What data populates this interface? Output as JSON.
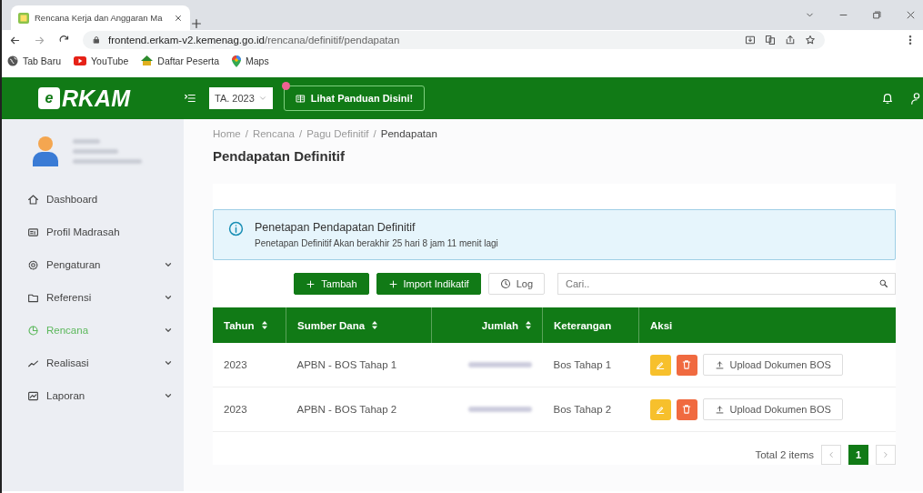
{
  "browser": {
    "tab_title": "Rencana Kerja dan Anggaran Ma",
    "url_host": "frontend.erkam-v2.kemenag.go.id",
    "url_path": "/rencana/definitif/pendapatan",
    "bookmarks": [
      {
        "label": "Tab Baru",
        "kind": "globe"
      },
      {
        "label": "YouTube",
        "kind": "youtube"
      },
      {
        "label": "Daftar Peserta",
        "kind": "emblem"
      },
      {
        "label": "Maps",
        "kind": "maps"
      }
    ]
  },
  "header": {
    "logo": "RKAM",
    "logo_mark": "e",
    "year_select": "TA. 2023",
    "guide_button": "Lihat Panduan Disini!"
  },
  "sidebar": {
    "items": [
      {
        "label": "Dashboard",
        "kind": "link",
        "selected": false
      },
      {
        "label": "Profil Madrasah",
        "kind": "link",
        "selected": false
      },
      {
        "label": "Pengaturan",
        "kind": "group",
        "selected": false
      },
      {
        "label": "Referensi",
        "kind": "group",
        "selected": false
      },
      {
        "label": "Rencana",
        "kind": "group",
        "selected": true
      },
      {
        "label": "Realisasi",
        "kind": "group",
        "selected": false
      },
      {
        "label": "Laporan",
        "kind": "group",
        "selected": false
      }
    ]
  },
  "breadcrumb": {
    "separator": "/",
    "items": [
      {
        "label": "Home",
        "current": false
      },
      {
        "label": "Rencana",
        "current": false
      },
      {
        "label": "Pagu Definitif",
        "current": false
      },
      {
        "label": "Pendapatan",
        "current": true
      }
    ]
  },
  "page_title": "Pendapatan Definitif",
  "alert": {
    "title": "Penetapan Pendapatan Definitif",
    "message": "Penetapan Definitif Akan berakhir 25 hari 8 jam 11 menit lagi"
  },
  "toolbar": {
    "add_button": "Tambah",
    "import_button": "Import Indikatif",
    "log_button": "Log",
    "search": {
      "placeholder": "Cari.."
    }
  },
  "table": {
    "columns": [
      {
        "label": "Tahun",
        "sortable": true
      },
      {
        "label": "Sumber Dana",
        "sortable": true
      },
      {
        "label": "Jumlah",
        "sortable": true
      },
      {
        "label": "Keterangan",
        "sortable": false
      },
      {
        "label": "Aksi",
        "sortable": false
      }
    ],
    "rows": [
      {
        "tahun": "2023",
        "sumber_dana": "APBN - BOS Tahap 1",
        "keterangan": "Bos Tahap 1",
        "upload_button": "Upload Dokumen BOS"
      },
      {
        "tahun": "2023",
        "sumber_dana": "APBN - BOS Tahap 2",
        "keterangan": "Bos Tahap 2",
        "upload_button": "Upload Dokumen BOS"
      }
    ]
  },
  "pagination": {
    "total": "Total 2 items",
    "pages": [
      {
        "label": "1",
        "selected": true
      }
    ]
  }
}
